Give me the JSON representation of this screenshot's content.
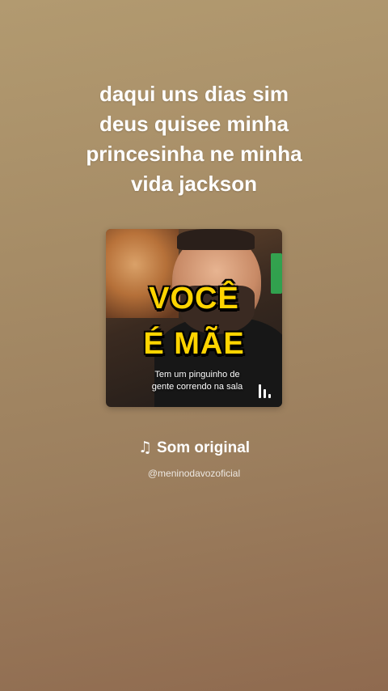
{
  "story": {
    "caption": "daqui uns dias  sim\ndeus quisee minha\nprincesinha ne minha\nvida jackson"
  },
  "music_card": {
    "cover": {
      "headline_line1": "VOCÊ",
      "headline_line2": "É MÃE",
      "subtitle": "Tem um pinguinho de\ngente correndo na sala",
      "playing_icon": "audio-bars-icon"
    },
    "sound_icon": "music-note-icon",
    "sound_note_glyph": "♫",
    "sound_label": "Som original",
    "artist_handle": "@meninodavozoficial"
  },
  "colors": {
    "background_top": "#b29a70",
    "background_bottom": "#8f6a4f",
    "headline_yellow": "#ffd400"
  }
}
